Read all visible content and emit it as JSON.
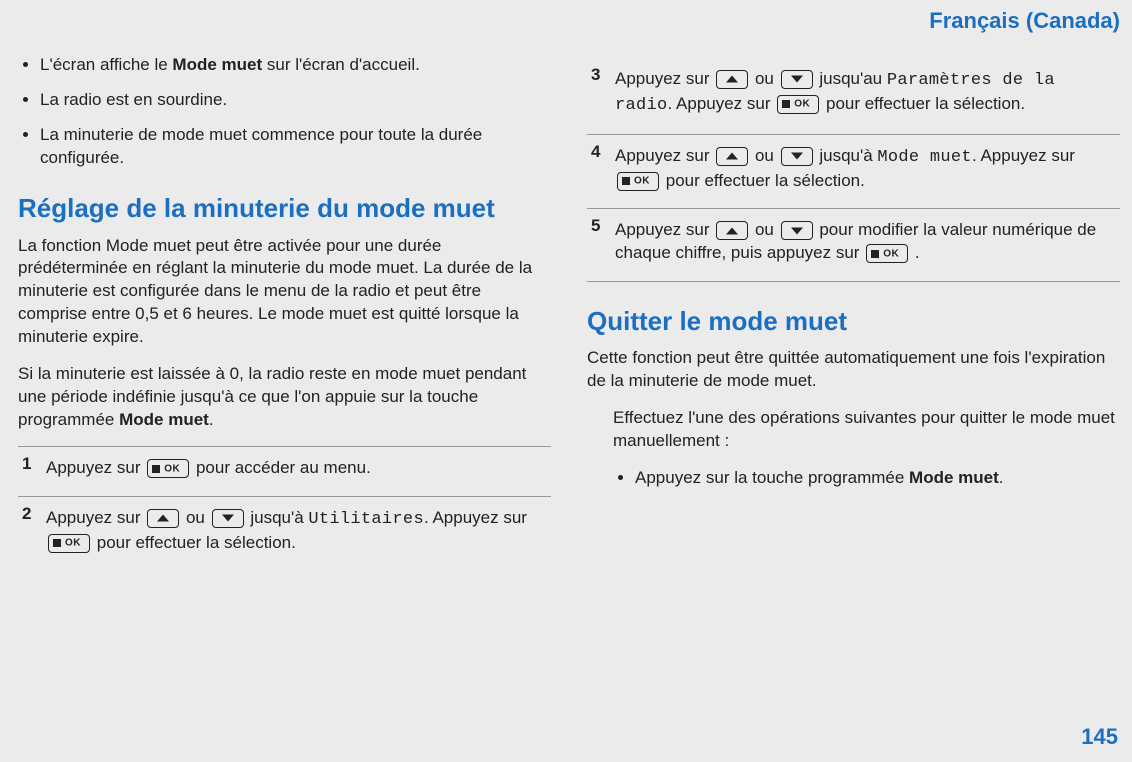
{
  "language_label": "Français (Canada)",
  "page_number": "145",
  "left": {
    "bullets": [
      {
        "pre": "L'écran affiche le ",
        "bold": "Mode muet",
        "post": " sur l'écran d'accueil."
      },
      {
        "pre": "La radio est en sourdine.",
        "bold": "",
        "post": ""
      },
      {
        "pre": "La minuterie de mode muet commence pour toute la durée configurée.",
        "bold": "",
        "post": ""
      }
    ],
    "h2": "Réglage de la minuterie du mode muet",
    "p1": "La fonction Mode muet peut être activée pour une durée prédéterminée en réglant la minuterie du mode muet. La durée de la minuterie est configurée dans le menu de la radio et peut être comprise entre 0,5 et 6 heures. Le mode muet est quitté lorsque la minuterie expire.",
    "p2_pre": "Si la minuterie est laissée à 0, la radio reste en mode muet pendant une période indéfinie jusqu'à ce que l'on appuie sur la touche programmée ",
    "p2_bold": "Mode muet",
    "p2_post": ".",
    "step1_a": "Appuyez sur ",
    "step1_b": " pour accéder au menu.",
    "step2_a": "Appuyez sur ",
    "step2_b": " ou ",
    "step2_c": " jusqu'à ",
    "step2_mono": "Utilitaires",
    "step2_d": ". Appuyez sur ",
    "step2_e": " pour effectuer la sélection."
  },
  "right": {
    "step3_a": "Appuyez sur ",
    "step3_b": " ou ",
    "step3_c": " jusqu'au ",
    "step3_mono": "Paramètres de la radio",
    "step3_d": ". Appuyez sur ",
    "step3_e": " pour effectuer la sélection.",
    "step4_a": "Appuyez sur ",
    "step4_b": " ou ",
    "step4_c": " jusqu'à ",
    "step4_mono": "Mode muet",
    "step4_d": ". Appuyez sur ",
    "step4_e": " pour effectuer la sélection.",
    "step5_a": "Appuyez sur ",
    "step5_b": " ou ",
    "step5_c": " pour modifier la valeur numérique de chaque chiffre, puis appuyez sur ",
    "step5_d": ".",
    "h2": "Quitter le mode muet",
    "p1": "Cette fonction peut être quittée automatiquement une fois l'expiration de la minuterie de mode muet.",
    "p2": "Effectuez l'une des opérations suivantes pour quitter le mode muet manuellement :",
    "sub_pre": "Appuyez sur la touche programmée ",
    "sub_bold": "Mode muet",
    "sub_post": "."
  }
}
